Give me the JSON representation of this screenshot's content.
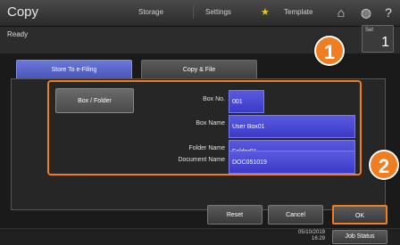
{
  "header": {
    "title": "Copy",
    "tabs": [
      "Storage",
      "Settings",
      "Template"
    ],
    "icons": [
      "star-icon",
      "home-icon",
      "globe-icon",
      "help-icon"
    ]
  },
  "status": {
    "text": "Ready"
  },
  "set_counter": {
    "label": "Set",
    "value": "1"
  },
  "mode_tabs": {
    "store": "Store To e-Filing",
    "copy_file": "Copy & File"
  },
  "form": {
    "box_folder_button": "Box / Folder",
    "fields": [
      {
        "label": "Box No.",
        "value": "001"
      },
      {
        "label": "Box Name",
        "value": "User Box01"
      },
      {
        "label": "Folder Name",
        "value": "Folder01"
      },
      {
        "label": "Document Name",
        "value": "DOC051019"
      }
    ]
  },
  "callouts": [
    "1",
    "2"
  ],
  "actions": {
    "reset": "Reset",
    "cancel": "Cancel",
    "ok": "OK"
  },
  "footer": {
    "date": "05/10/2019",
    "time": "16:29",
    "job_status": "Job Status"
  },
  "colors": {
    "accent": "#f07d1f",
    "field_blue": "#4a4ad8",
    "tab_active": "#5a66c8"
  }
}
